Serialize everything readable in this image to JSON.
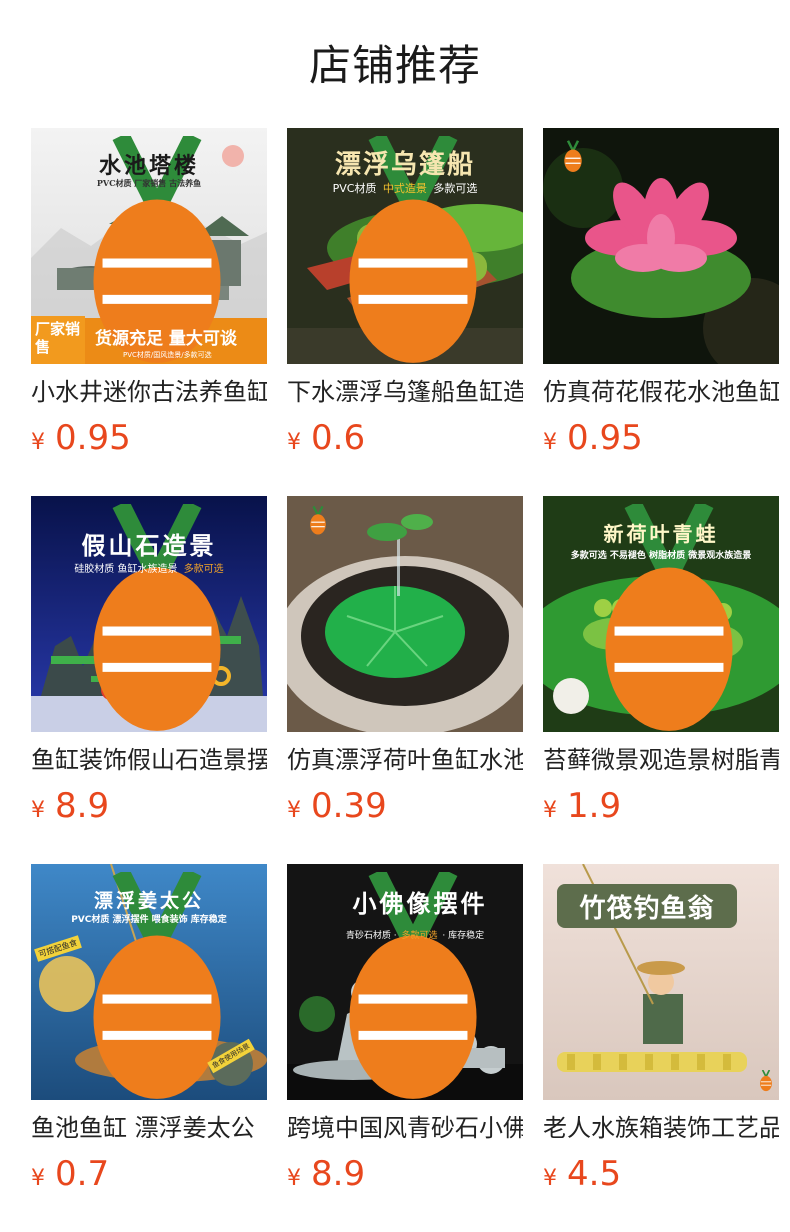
{
  "header": {
    "title": "店铺推荐"
  },
  "products": [
    {
      "name": "小水井迷你古法养鱼缸",
      "currency": "¥",
      "price": "0.95",
      "image_text": {
        "title": "水池塔楼",
        "sub": "PVC材质 厂家销售 古法养鱼",
        "tag": "厂家销售",
        "banner": "货源充足 量大可谈",
        "small": "PVC材质/国风造景/多款可选"
      }
    },
    {
      "name": "下水漂浮乌篷船鱼缸造景",
      "currency": "¥",
      "price": "0.6",
      "image_text": {
        "title": "漂浮乌篷船",
        "sub": "PVC材质",
        "highlight": "中式造景",
        "sub2": "多款可选"
      }
    },
    {
      "name": "仿真荷花假花水池鱼缸",
      "currency": "¥",
      "price": "0.95",
      "image_text": {}
    },
    {
      "name": "鱼缸装饰假山石造景摆件",
      "currency": "¥",
      "price": "8.9",
      "image_text": {
        "title": "假山石造景",
        "sub": "硅胶材质 鱼缸水族造景",
        "highlight": "多款可选"
      }
    },
    {
      "name": "仿真漂浮荷叶鱼缸水池",
      "currency": "¥",
      "price": "0.39",
      "image_text": {}
    },
    {
      "name": "苔藓微景观造景树脂青蛙",
      "currency": "¥",
      "price": "1.9",
      "image_text": {
        "title": "新荷叶青蛙",
        "sub": "多款可选 不易褪色 树脂材质 微景观水族造景"
      }
    },
    {
      "name": "鱼池鱼缸 漂浮姜太公",
      "currency": "¥",
      "price": "0.7",
      "image_text": {
        "title": "漂浮姜太公",
        "sub": "PVC材质 漂浮摆件 喂食装饰 库存稳定",
        "tag": "可搭配鱼食",
        "tag2": "鱼食使用场景"
      }
    },
    {
      "name": "跨境中国风青砂石小佛像",
      "currency": "¥",
      "price": "8.9",
      "image_text": {
        "title": "小佛像摆件",
        "sub": "青砂石材质 ·",
        "highlight": "多款可选",
        "sub2": "· 库存稳定"
      }
    },
    {
      "name": "老人水族箱装饰工艺品",
      "currency": "¥",
      "price": "4.5",
      "image_text": {
        "title": "竹筏钓鱼翁"
      }
    }
  ]
}
